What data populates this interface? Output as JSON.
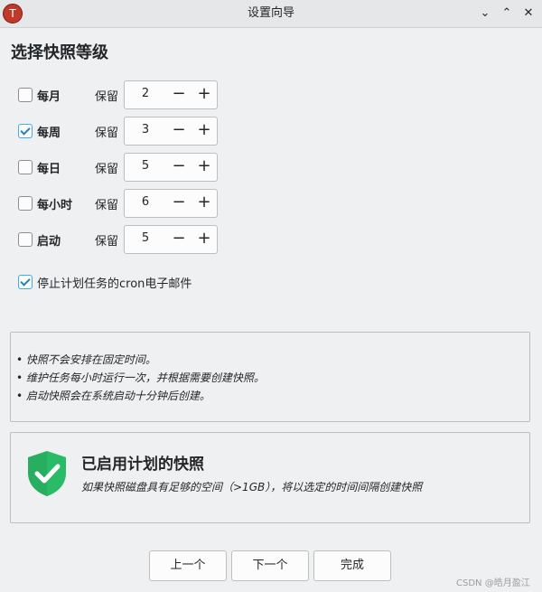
{
  "window": {
    "title": "设置向导",
    "controls": [
      "chevron-down-icon",
      "chevron-up-icon",
      "close-icon"
    ]
  },
  "heading": "选择快照等级",
  "keep_label": "保留",
  "levels": [
    {
      "label": "每月",
      "checked": false,
      "value": "2"
    },
    {
      "label": "每周",
      "checked": true,
      "value": "3"
    },
    {
      "label": "每日",
      "checked": false,
      "value": "5"
    },
    {
      "label": "每小时",
      "checked": false,
      "value": "6"
    },
    {
      "label": "启动",
      "checked": false,
      "value": "5"
    }
  ],
  "stepper": {
    "minus": "−",
    "plus": "+"
  },
  "option": {
    "label": "停止计划任务的cron电子邮件",
    "checked": true
  },
  "info": {
    "lines": [
      "• 快照不会安排在固定时间。",
      "• 维护任务每小时运行一次，并根据需要创建快照。",
      "• 启动快照会在系统启动十分钟后创建。"
    ]
  },
  "status": {
    "title": "已启用计划的快照",
    "description": "如果快照磁盘具有足够的空间（>1GB），将以选定的时间间隔创建快照",
    "icon": "shield-check-icon",
    "color": "#27ae60"
  },
  "buttons": {
    "prev": "上一个",
    "next": "下一个",
    "finish": "完成"
  },
  "watermark": "CSDN @皓月盈江",
  "colors": {
    "accent": "#3daee9",
    "background": "#eff0f1",
    "titlebar": "#e6e7e8"
  }
}
